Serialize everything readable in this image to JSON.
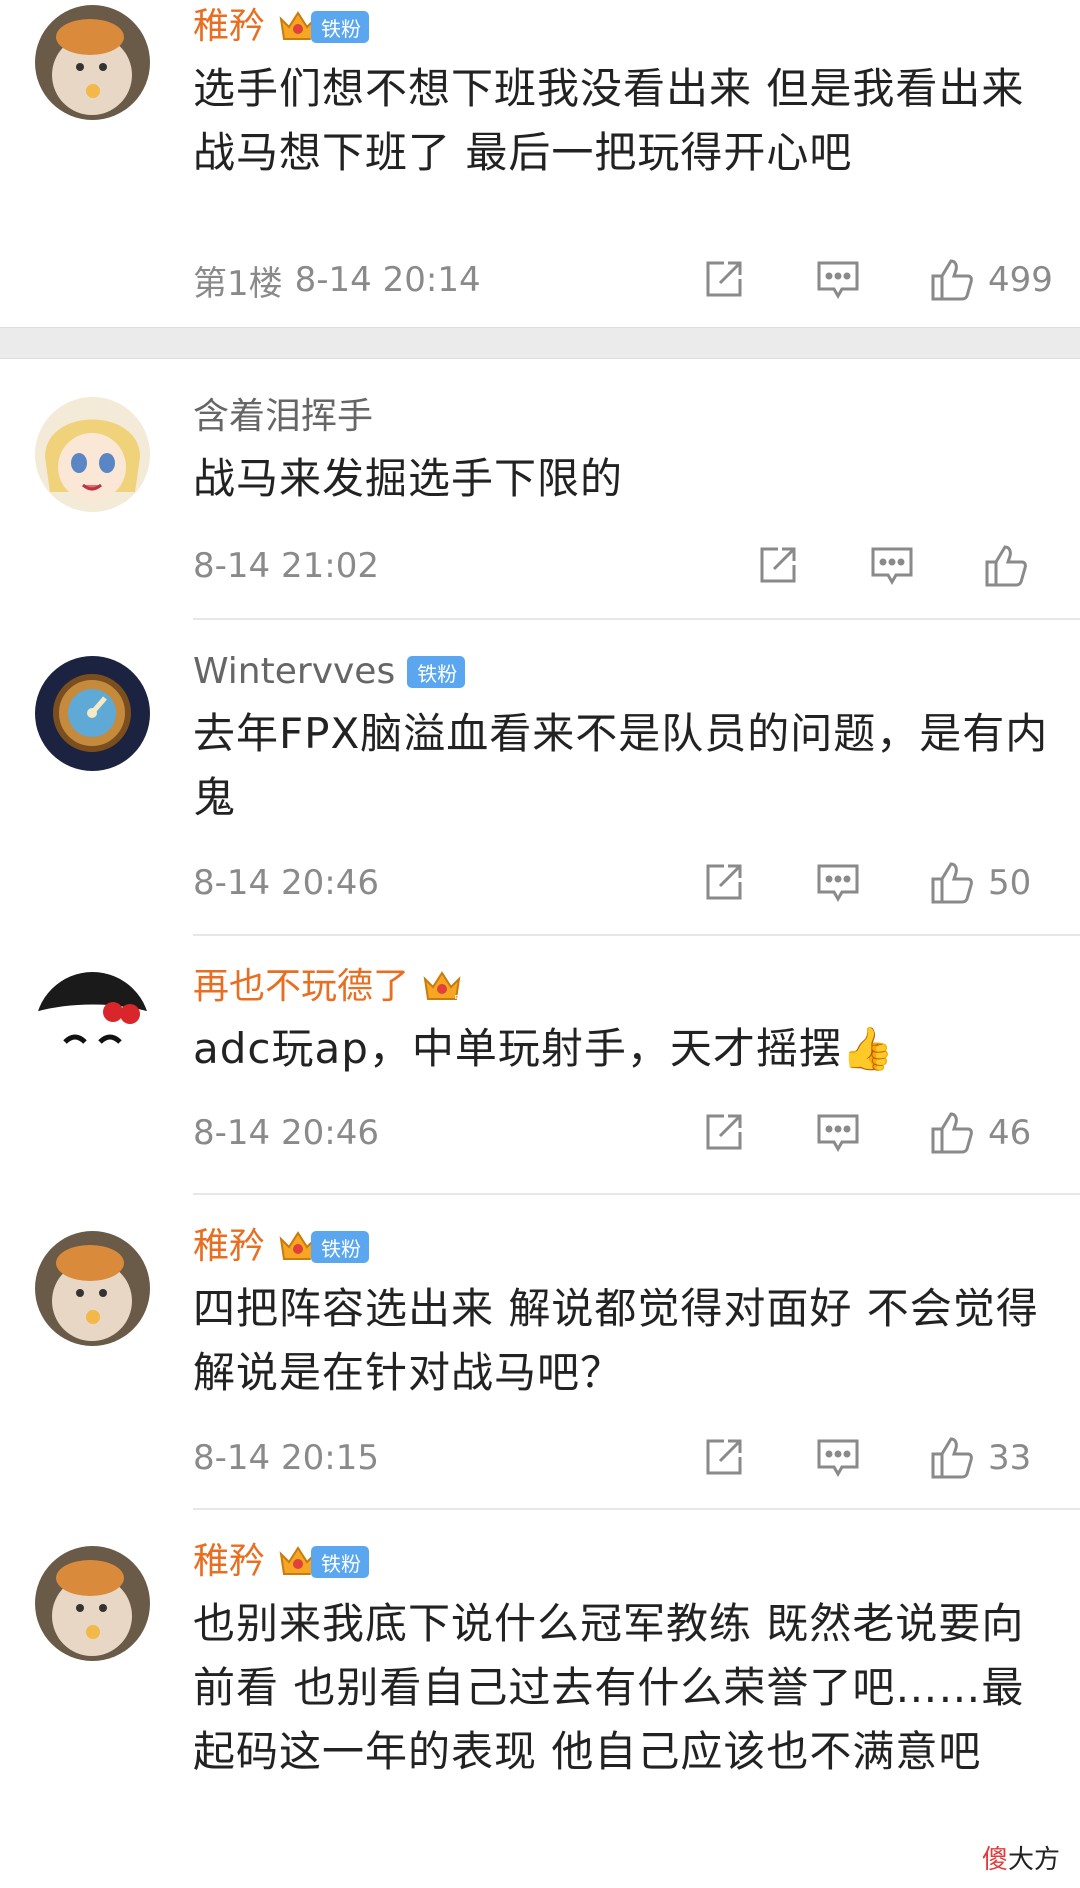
{
  "comments": [
    {
      "id": "c1",
      "username": "稚矜",
      "crown_level": "6",
      "fan_badge": "铁粉",
      "text": "选手们想不想下班我没看出来 但是我看出来战马想下班了 最后一把玩得开心吧",
      "floor": "第1楼",
      "time": "8-14 20:14",
      "likes": "499"
    },
    {
      "id": "c2",
      "username": "含着泪挥手",
      "text": "战马来发掘选手下限的",
      "time": "8-14 21:02",
      "likes": ""
    },
    {
      "id": "c3",
      "username": "Wintervves",
      "fan_badge": "铁粉",
      "text": "去年FPX脑溢血看来不是队员的问题，是有内鬼",
      "time": "8-14 20:46",
      "likes": "50"
    },
    {
      "id": "c4",
      "username": "再也不玩德了",
      "crown_level": "5",
      "text": "adc玩ap，中单玩射手，天才摇摆👍",
      "time": "8-14 20:46",
      "likes": "46"
    },
    {
      "id": "c5",
      "username": "稚矜",
      "crown_level": "6",
      "fan_badge": "铁粉",
      "text": "四把阵容选出来 解说都觉得对面好 不会觉得解说是在针对战马吧？",
      "time": "8-14 20:15",
      "likes": "33"
    },
    {
      "id": "c6",
      "username": "稚矜",
      "crown_level": "6",
      "fan_badge": "铁粉",
      "text": "也别来我底下说什么冠军教练 既然老说要向前看 也别看自己过去有什么荣誉了吧……最起码这一年的表现 他自己应该也不满意吧"
    }
  ],
  "watermark": {
    "part1": "傻",
    "part2": "大方"
  },
  "colors": {
    "username_orange": "#e86f22",
    "username_gray": "#666666",
    "fan_badge_blue": "#5aa7ef",
    "meta_gray": "#8a8a8a",
    "section_gap": "#ebebeb"
  },
  "icons": [
    "share-icon",
    "comment-icon",
    "thumbs-up-icon",
    "crown-icon"
  ]
}
